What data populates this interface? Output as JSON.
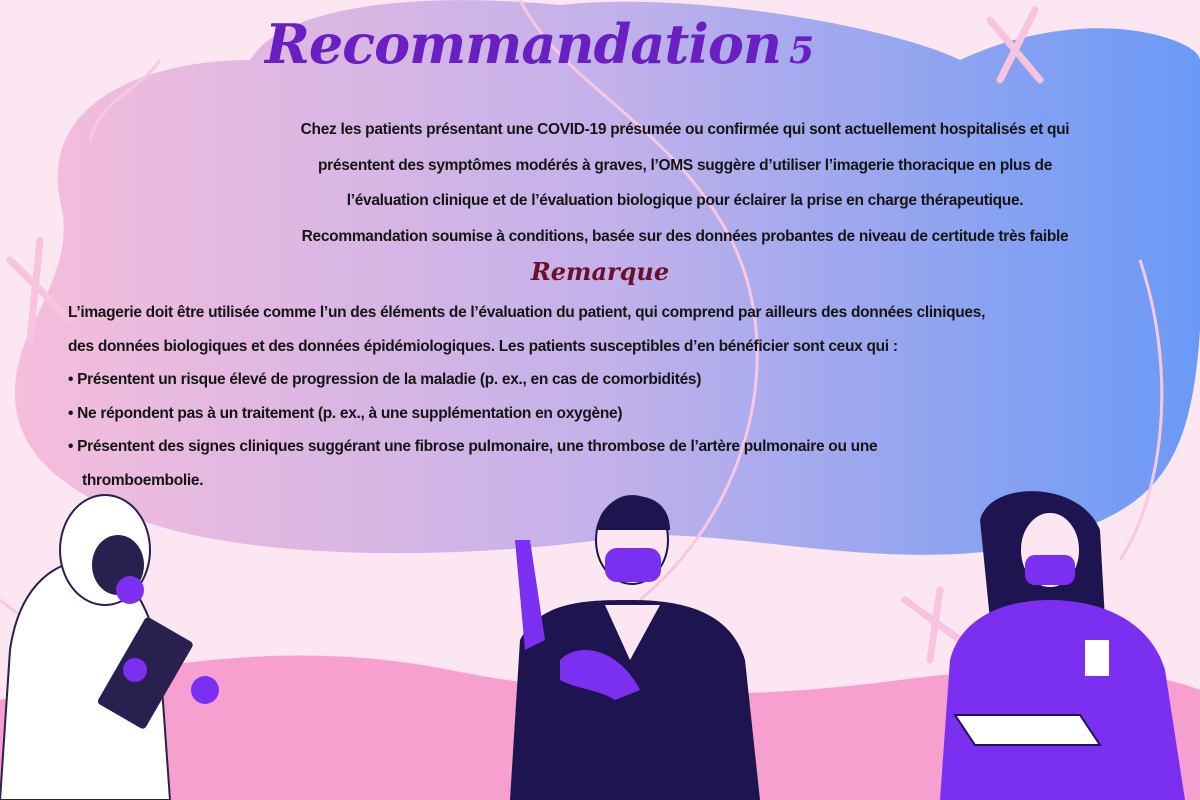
{
  "title": {
    "text": "Recommandation",
    "number": "5"
  },
  "recommendation": {
    "lines": [
      "Chez les patients présentant une COVID-19 présumée ou confirmée qui sont actuellement hospitalisés et qui",
      "présentent des symptômes modérés à graves, l’OMS suggère d’utiliser l’imagerie thoracique en plus de",
      "l’évaluation clinique et de l’évaluation biologique pour éclairer la prise en charge thérapeutique.",
      "Recommandation soumise à conditions, basée sur des données probantes de niveau de certitude très faible"
    ]
  },
  "remark": {
    "title": "Remarque",
    "intro_lines": [
      "L’imagerie doit être utilisée comme l’un des éléments de l’évaluation du patient, qui comprend par ailleurs des données cliniques,",
      "des données biologiques et des données épidémiologiques. Les patients susceptibles d’en bénéficier sont ceux qui :"
    ],
    "bullets": [
      "• Présentent un risque élevé de progression de la maladie (p. ex., en cas de comorbidités)",
      "• Ne répondent pas à un traitement (p. ex., à une supplémentation en oxygène)",
      "• Présentent des signes cliniques suggérant une fibrose pulmonaire, une thrombose de l’artère pulmonaire ou une"
    ],
    "bullet_continuation": "thromboembolie."
  },
  "colors": {
    "background": "#fce6f1",
    "blob_left": "#f4b9dc",
    "blob_right": "#6a9af6",
    "title": "#6a1fc2",
    "remark_title": "#6b0f2e",
    "wave": "#f79fcf",
    "accent_purple": "#7b2ff0",
    "navy": "#1e1550"
  }
}
